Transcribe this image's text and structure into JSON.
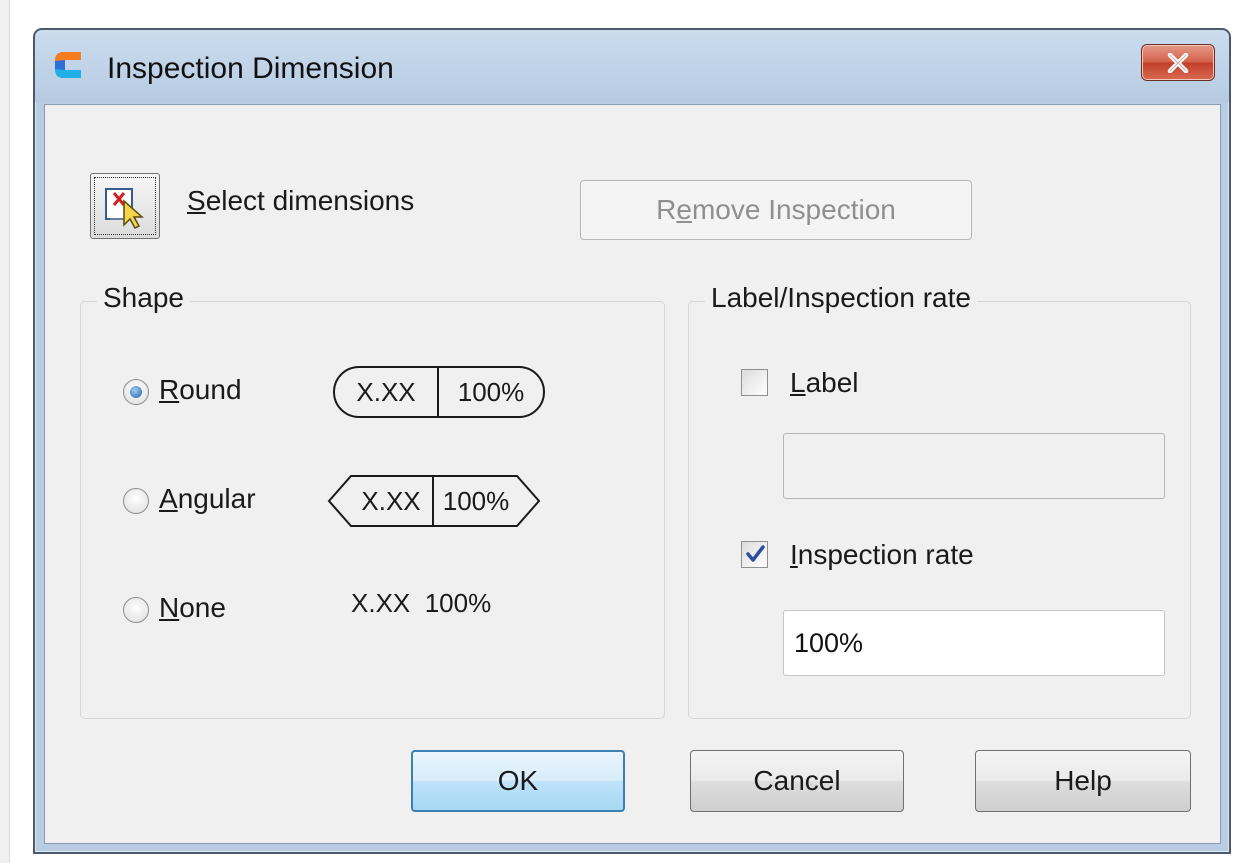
{
  "window": {
    "title": "Inspection Dimension",
    "close_icon": "close-x-icon",
    "app_icon": "gcad-logo-icon"
  },
  "select": {
    "icon": "select-object-icon",
    "label_accel": "S",
    "label_rest": "elect dimensions"
  },
  "remove_button": {
    "pre": "R",
    "accel": "e",
    "rest": "move Inspection",
    "enabled": false
  },
  "shape_group": {
    "title": "Shape",
    "options": [
      {
        "accel": "R",
        "rest": "ound",
        "checked": true,
        "preview_value": "X.XX",
        "preview_rate": "100%",
        "preview_style": "round"
      },
      {
        "accel": "A",
        "rest": "ngular",
        "checked": false,
        "preview_value": "X.XX",
        "preview_rate": "100%",
        "preview_style": "angular"
      },
      {
        "accel": "N",
        "rest": "one",
        "checked": false,
        "preview_text": "X.XX  100%",
        "preview_style": "none"
      }
    ]
  },
  "label_group": {
    "title": "Label/Inspection rate",
    "label_checkbox": {
      "accel": "L",
      "rest": "abel",
      "checked": false
    },
    "label_value": "",
    "rate_checkbox": {
      "accel": "I",
      "rest": "nspection rate",
      "checked": true
    },
    "rate_value": "100%"
  },
  "buttons": {
    "ok": "OK",
    "cancel": "Cancel",
    "help": "Help"
  },
  "colors": {
    "title_bar": "#b6cbe2",
    "close_button": "#c3402a",
    "default_button_border": "#3c7fb1",
    "dialog_background": "#f0f0f0"
  }
}
